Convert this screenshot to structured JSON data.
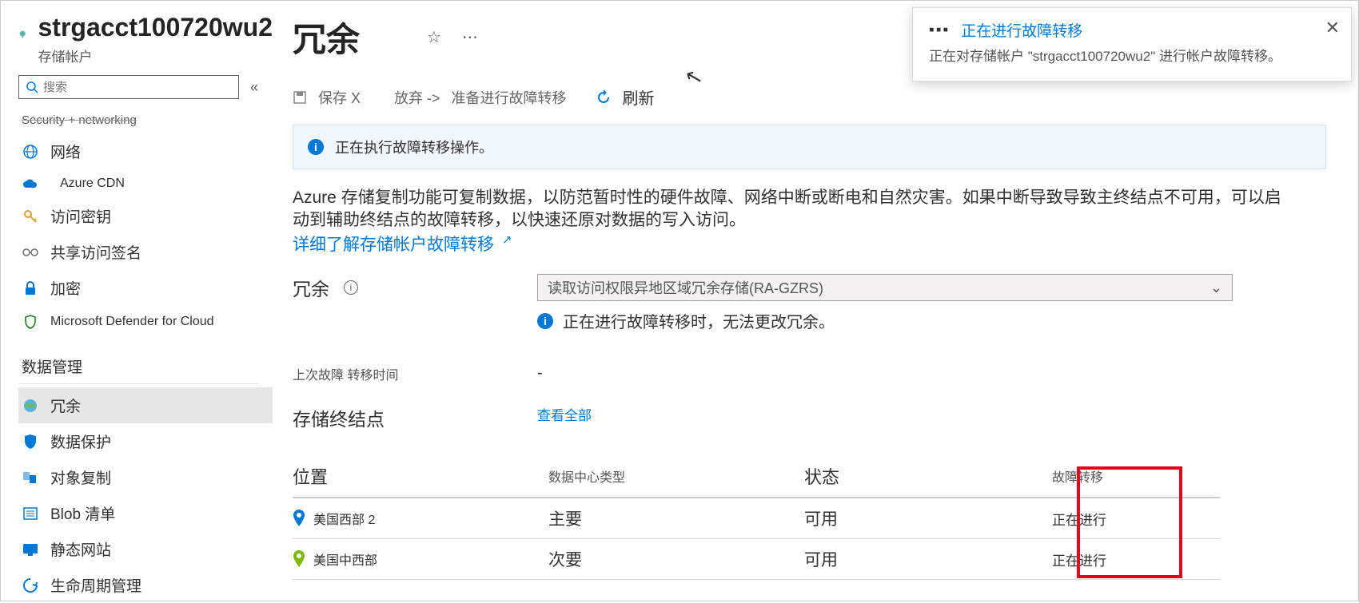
{
  "header": {
    "account": "strgacct100720wu2",
    "subtitle": "存储帐户",
    "pipe": " | ",
    "page_title": "冗余"
  },
  "search": {
    "placeholder": "搜索"
  },
  "nav": {
    "truncated": "Security + networking",
    "network": "网络",
    "cdn": "Azure CDN",
    "keys": "访问密钥",
    "sas": "共享访问签名",
    "encryption": "加密",
    "defender": "Microsoft Defender for Cloud",
    "section_data": "数据管理",
    "redundancy": "冗余",
    "protection": "数据保护",
    "replication": "对象复制",
    "blob_inventory": "Blob 清单",
    "static_site": "静态网站",
    "lifecycle": "生命周期管理"
  },
  "toolbar": {
    "save": "保存 X",
    "discard": "放弃 ->",
    "prepare": "准备进行故障转移",
    "refresh": "刷新"
  },
  "banner": "正在执行故障转移操作。",
  "desc": {
    "line": "Azure 存储复制功能可复制数据，以防范暂时性的硬件故障、网络中断或断电和自然灾害。如果中断导致导致主终结点不可用，可以启动到辅助终结点的故障转移，以快速还原对数据的写入访问。",
    "link": "详细了解存储帐户故障转移"
  },
  "form": {
    "redundancy_label": "冗余",
    "redundancy_value": "读取访问权限异地区域冗余存储(RA-GZRS)",
    "note": "正在进行故障转移时，无法更改冗余。",
    "lastfail_label": "上次故障 转移时间",
    "lastfail_value": "-",
    "endpoints_label": "存储终结点",
    "view_all": "查看全部"
  },
  "table": {
    "h_location": "位置",
    "h_dctype": "数据中心类型",
    "h_status": "状态",
    "h_failover": "故障转移",
    "rows": [
      {
        "loc": "美国西部 2",
        "dc": "主要",
        "status": "可用",
        "fo": "正在进行"
      },
      {
        "loc": "美国中西部",
        "dc": "次要",
        "status": "可用",
        "fo": "正在进行"
      }
    ]
  },
  "toast": {
    "title": "正在进行故障转移",
    "body": "正在对存储帐户 \"strgacct100720wu2\" 进行帐户故障转移。"
  }
}
